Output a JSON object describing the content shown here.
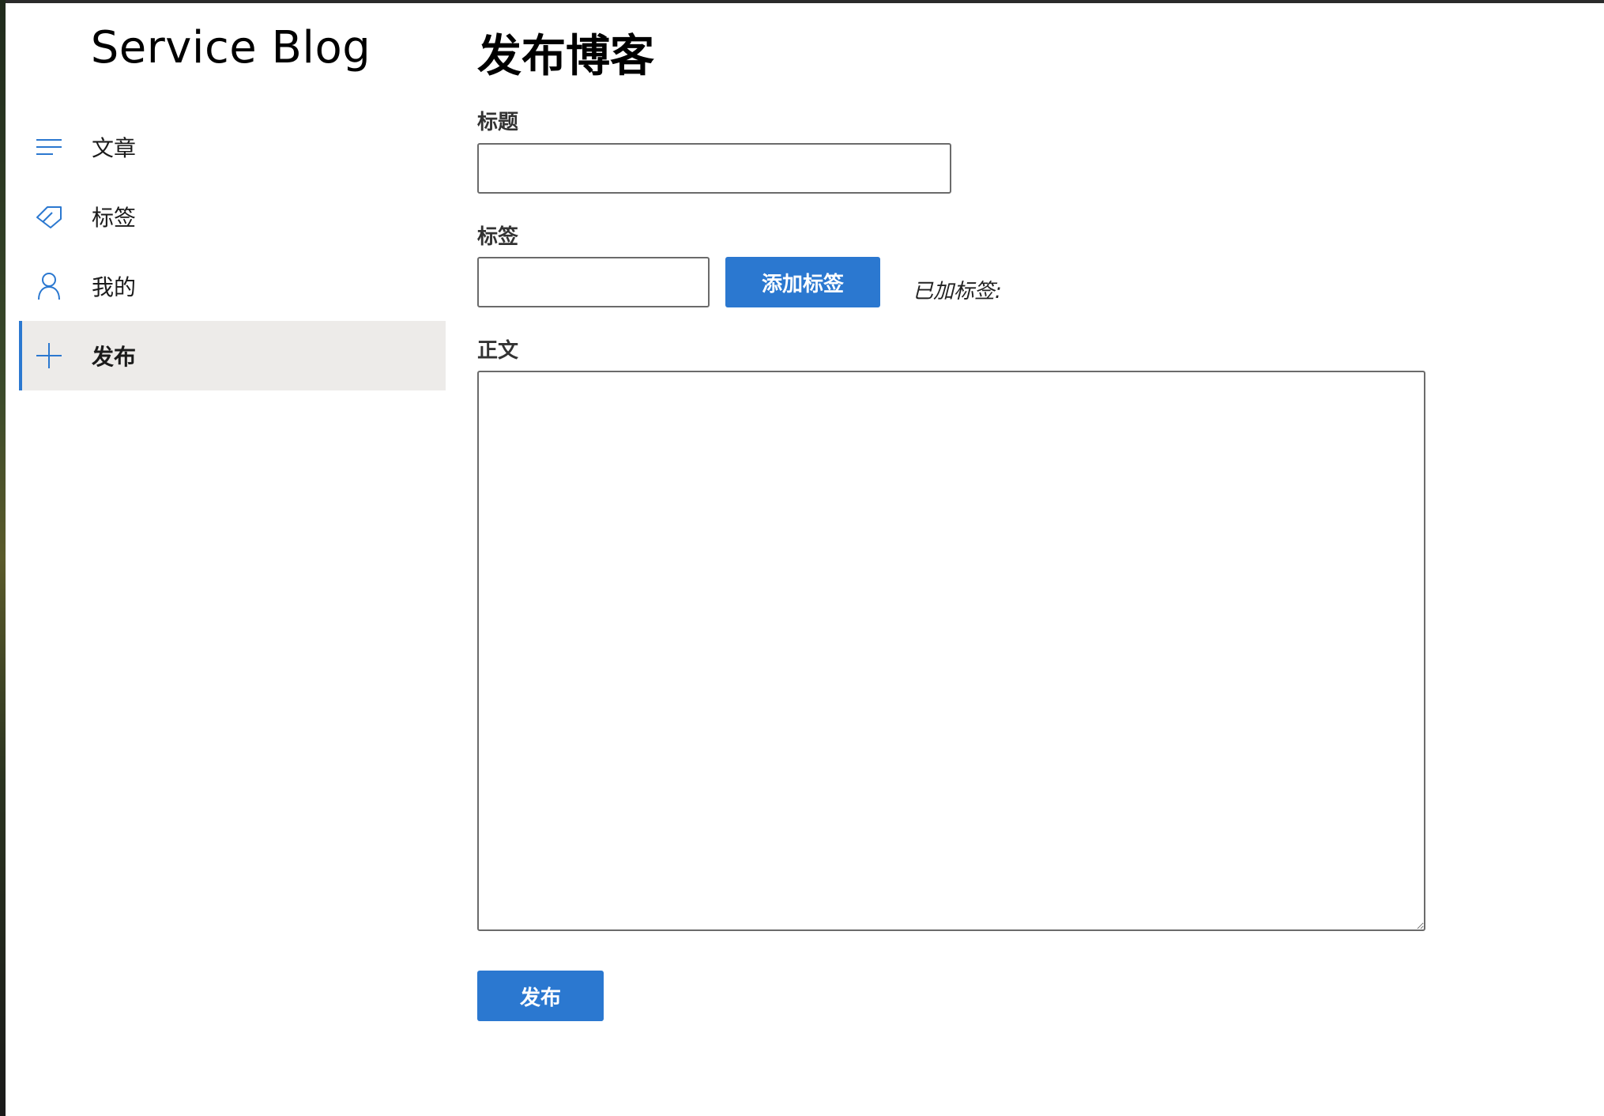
{
  "sidebar": {
    "brand": "Service Blog",
    "items": [
      {
        "label": "文章",
        "icon": "list-icon",
        "active": false
      },
      {
        "label": "标签",
        "icon": "tag-icon",
        "active": false
      },
      {
        "label": "我的",
        "icon": "person-icon",
        "active": false
      },
      {
        "label": "发布",
        "icon": "plus-icon",
        "active": true
      }
    ]
  },
  "main": {
    "title": "发布博客",
    "title_field": {
      "label": "标题",
      "value": "",
      "placeholder": ""
    },
    "tag_field": {
      "label": "标签",
      "value": "",
      "placeholder": "",
      "add_button": "添加标签",
      "added_label": "已加标签:"
    },
    "body_field": {
      "label": "正文",
      "value": "",
      "placeholder": ""
    },
    "submit_button": "发布"
  },
  "colors": {
    "accent": "#2b78d0",
    "active_bg": "#edebe9",
    "text": "#111111"
  }
}
